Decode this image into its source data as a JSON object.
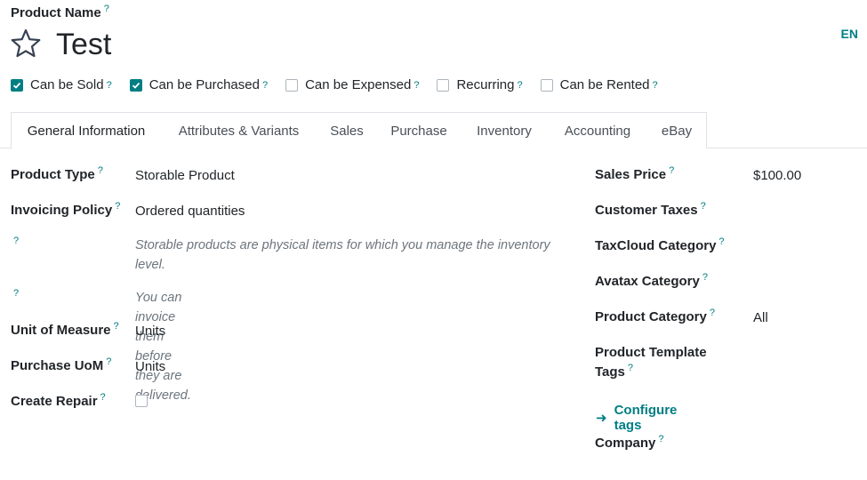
{
  "header": {
    "product_name_label": "Product Name",
    "help_mark": "?",
    "title": "Test",
    "language": "EN"
  },
  "flags": [
    {
      "label": "Can be Sold",
      "checked": true
    },
    {
      "label": "Can be Purchased",
      "checked": true
    },
    {
      "label": "Can be Expensed",
      "checked": false
    },
    {
      "label": "Recurring",
      "checked": false
    },
    {
      "label": "Can be Rented",
      "checked": false
    }
  ],
  "tabs": [
    {
      "label": "General Information",
      "active": true
    },
    {
      "label": "Attributes & Variants"
    },
    {
      "label": "Sales"
    },
    {
      "label": "Purchase"
    },
    {
      "label": "Inventory"
    },
    {
      "label": "Accounting"
    },
    {
      "label": "eBay"
    }
  ],
  "left": {
    "product_type_label": "Product Type",
    "product_type_value": "Storable Product",
    "invoicing_policy_label": "Invoicing Policy",
    "invoicing_policy_value": "Ordered quantities",
    "note_storable": "Storable products are physical items for which you manage the inventory level.",
    "note_invoice": "You can invoice them before they are delivered.",
    "uom_label": "Unit of Measure",
    "uom_value": "Units",
    "purchase_uom_label": "Purchase UoM",
    "purchase_uom_value": "Units",
    "create_repair_label": "Create Repair",
    "create_repair_checked": false
  },
  "right": {
    "sales_price_label": "Sales Price",
    "sales_price_value": "$100.00",
    "customer_taxes_label": "Customer Taxes",
    "taxcloud_label": "TaxCloud Category",
    "avatax_label": "Avatax Category",
    "product_category_label": "Product Category",
    "product_category_value": "All",
    "template_tags_label_line1": "Product Template",
    "template_tags_label_line2": "Tags",
    "configure_tags": "Configure tags",
    "company_label": "Company"
  },
  "colors": {
    "accent": "#017e84",
    "text": "#212529",
    "muted": "#6c757d",
    "border": "#dee2e6"
  }
}
